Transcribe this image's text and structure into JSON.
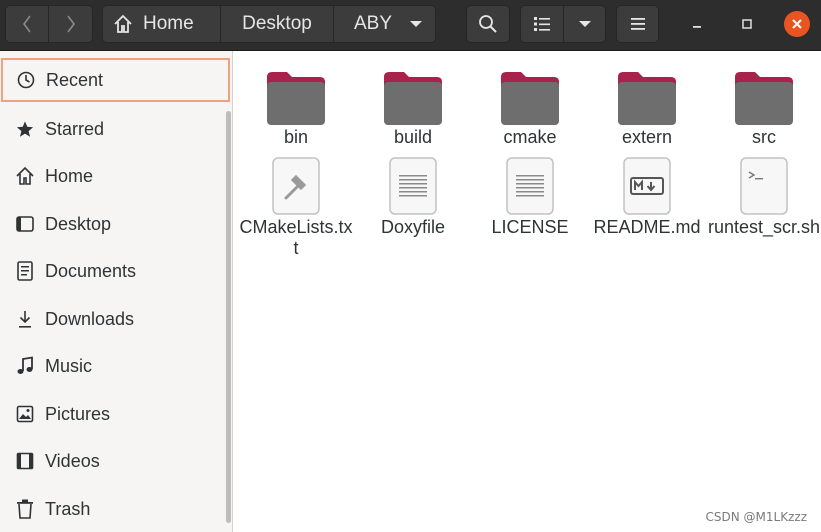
{
  "header": {
    "breadcrumbs": [
      "Home",
      "Desktop",
      "ABY"
    ],
    "icons": {
      "back": "chevron-left-icon",
      "forward": "chevron-right-icon",
      "home": "home-icon",
      "dropdown": "chevron-down-icon",
      "search": "search-icon",
      "view": "list-view-icon",
      "menu": "hamburger-menu-icon",
      "minimize": "minimize-icon",
      "maximize": "maximize-icon",
      "close": "close-icon"
    }
  },
  "sidebar": {
    "items": [
      {
        "label": "Recent",
        "icon": "clock-icon",
        "active": true
      },
      {
        "label": "Starred",
        "icon": "star-icon",
        "active": false
      },
      {
        "label": "Home",
        "icon": "home-icon",
        "active": false
      },
      {
        "label": "Desktop",
        "icon": "desktop-icon",
        "active": false
      },
      {
        "label": "Documents",
        "icon": "document-icon",
        "active": false
      },
      {
        "label": "Downloads",
        "icon": "download-icon",
        "active": false
      },
      {
        "label": "Music",
        "icon": "music-note-icon",
        "active": false
      },
      {
        "label": "Pictures",
        "icon": "picture-icon",
        "active": false
      },
      {
        "label": "Videos",
        "icon": "film-icon",
        "active": false
      },
      {
        "label": "Trash",
        "icon": "trash-icon",
        "active": false
      }
    ]
  },
  "files": [
    {
      "name": "bin",
      "type": "folder"
    },
    {
      "name": "build",
      "type": "folder"
    },
    {
      "name": "cmake",
      "type": "folder"
    },
    {
      "name": "extern",
      "type": "folder"
    },
    {
      "name": "src",
      "type": "folder"
    },
    {
      "name": "CMakeLists.txt",
      "type": "cmake-file"
    },
    {
      "name": "Doxyfile",
      "type": "text-file"
    },
    {
      "name": "LICENSE",
      "type": "text-file"
    },
    {
      "name": "README.md",
      "type": "markdown-file"
    },
    {
      "name": "runtest_scr.sh",
      "type": "script-file"
    }
  ],
  "watermark": "CSDN @M1LKzzz",
  "colors": {
    "header_bg": "#2d2d2d",
    "accent": "#e95420",
    "folder_tab": "#a8224b",
    "folder_body": "#6e6e6e",
    "active_border": "#f1a181"
  }
}
